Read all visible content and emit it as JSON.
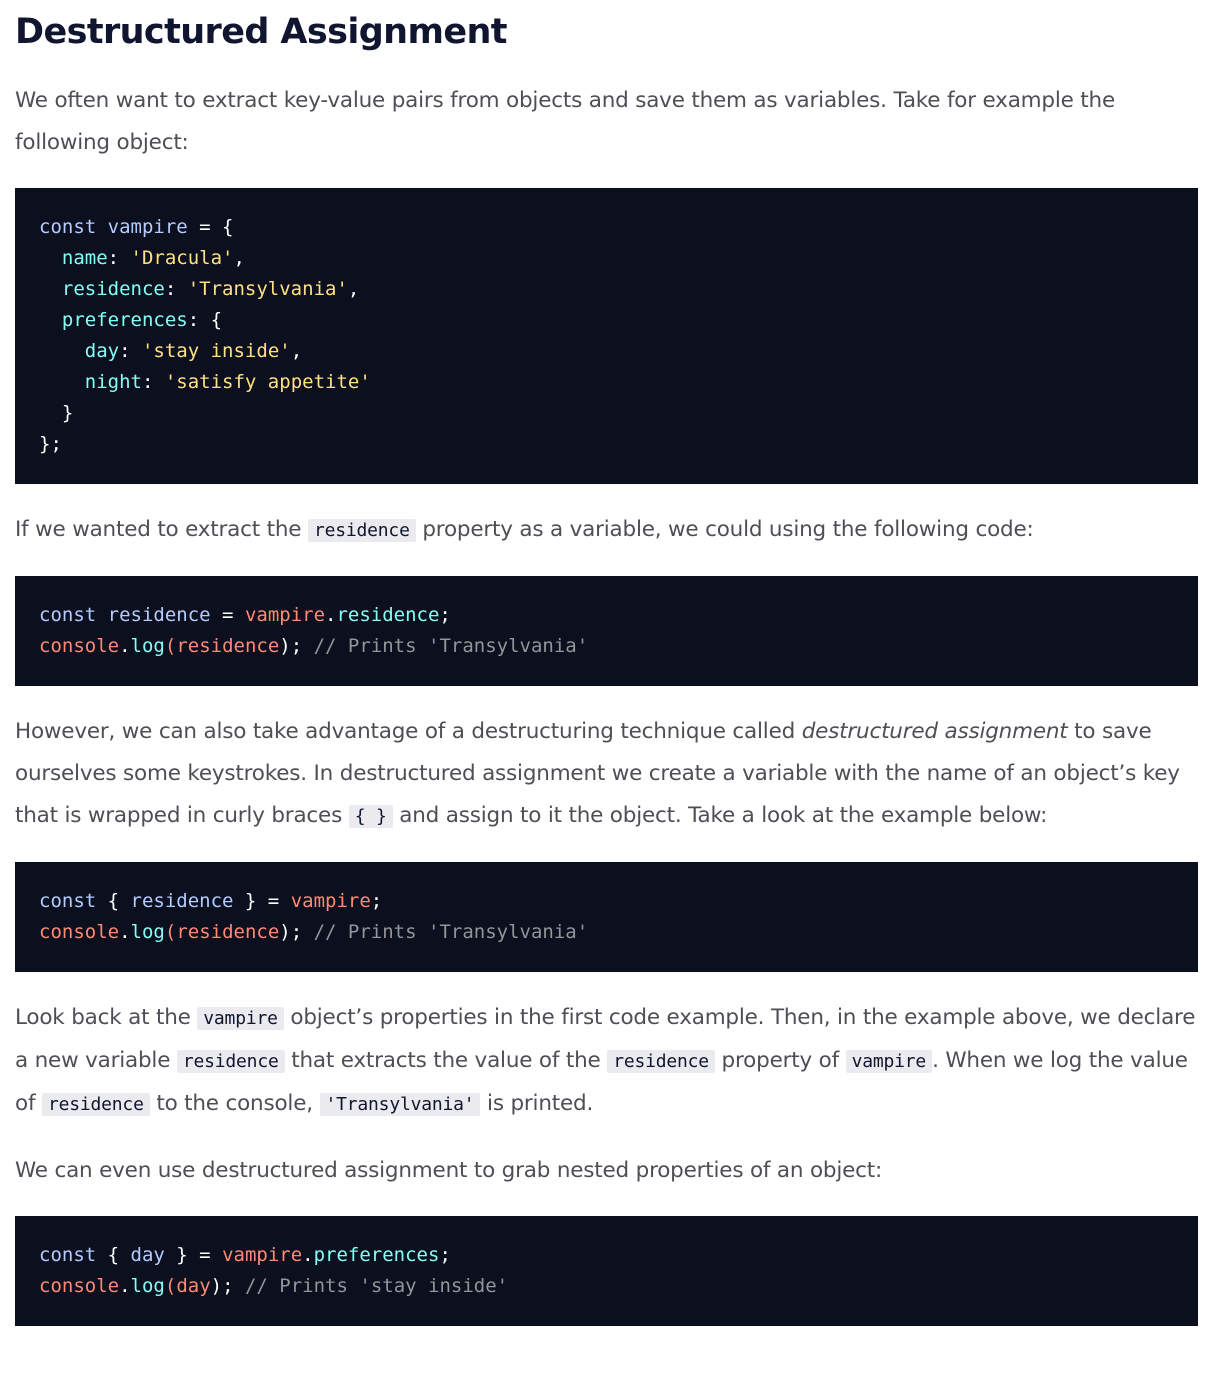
{
  "heading": "Destructured Assignment",
  "intro": {
    "text": "We often want to extract key-value pairs from objects and save them as variables. Take for example the following object:"
  },
  "code1": {
    "l1_const": "const",
    "l1_vampire": "vampire",
    "l1_rest": " = {",
    "l2_key": "name",
    "l2_colon": ": ",
    "l2_val": "'Dracula'",
    "l2_end": ",",
    "l3_key": "residence",
    "l3_colon": ": ",
    "l3_val": "'Transylvania'",
    "l3_end": ",",
    "l4_key": "preferences",
    "l4_rest": ": {",
    "l5_key": "day",
    "l5_colon": ": ",
    "l5_val": "'stay inside'",
    "l5_end": ",",
    "l6_key": "night",
    "l6_colon": ": ",
    "l6_val": "'satisfy appetite'",
    "l7": "}",
    "l8": "};"
  },
  "residence_para": {
    "before": "If we wanted to extract the ",
    "code": "residence",
    "after": " property as a variable, we could using the following code:"
  },
  "code2": {
    "l1_const": "const",
    "l1_residence": "residence",
    "l1_eq": " = ",
    "l1_vampire": "vampire",
    "l1_dot": ".",
    "l1_prop": "residence",
    "l1_semi": ";",
    "l2_console": "console",
    "l2_dot": ".",
    "l2_log": "log",
    "l2_open": "(",
    "l2_arg": "residence",
    "l2_close": ");",
    "l2_comment": "// Prints 'Transylvania'"
  },
  "however_para": {
    "before": "However, we can also take advantage of a destructuring technique called ",
    "em": "destructured assignment",
    "middle": " to save ourselves some keystrokes. In destructured assignment we create a variable with the name of an object’s key that is wrapped in curly braces ",
    "code": "{ }",
    "after": " and assign to it the object. Take a look at the example below:"
  },
  "code3": {
    "l1_const": "const",
    "l1_open": " { ",
    "l1_residence": "residence",
    "l1_close": " } = ",
    "l1_vampire": "vampire",
    "l1_semi": ";",
    "l2_console": "console",
    "l2_dot": ".",
    "l2_log": "log",
    "l2_open": "(",
    "l2_arg": "residence",
    "l2_close": ");",
    "l2_comment": "// Prints 'Transylvania'"
  },
  "lookback_para": {
    "t1": "Look back at the ",
    "c1": "vampire",
    "t2": " object’s properties in the first code example. Then, in the example above, we declare a new variable ",
    "c2": "residence",
    "t3": " that extracts the value of the ",
    "c3": "residence",
    "t4": " property of ",
    "c4": "vampire",
    "t5": ". When we log the value of ",
    "c5": "residence",
    "t6": " to the console, ",
    "c6": "'Transylvania'",
    "t7": " is printed."
  },
  "nested_para": {
    "text": "We can even use destructured assignment to grab nested properties of an object:"
  },
  "code4": {
    "l1_const": "const",
    "l1_open": " { ",
    "l1_day": "day",
    "l1_close": " } = ",
    "l1_vampire": "vampire",
    "l1_dot": ".",
    "l1_prop": "preferences",
    "l1_semi": ";",
    "l2_console": "console",
    "l2_dot": ".",
    "l2_log": "log",
    "l2_open": "(",
    "l2_arg": "day",
    "l2_close": ");",
    "l2_comment": "// Prints 'stay inside'"
  },
  "colors": {
    "code_background": "#0b0f1e",
    "keyword": "#b3ccff",
    "property": "#83fff5",
    "string": "#ffe083",
    "object": "#ff8973",
    "comment": "#939598",
    "inline_code_background": "#eaeaef",
    "heading": "#10162f",
    "body_text": "#4d4f55"
  }
}
